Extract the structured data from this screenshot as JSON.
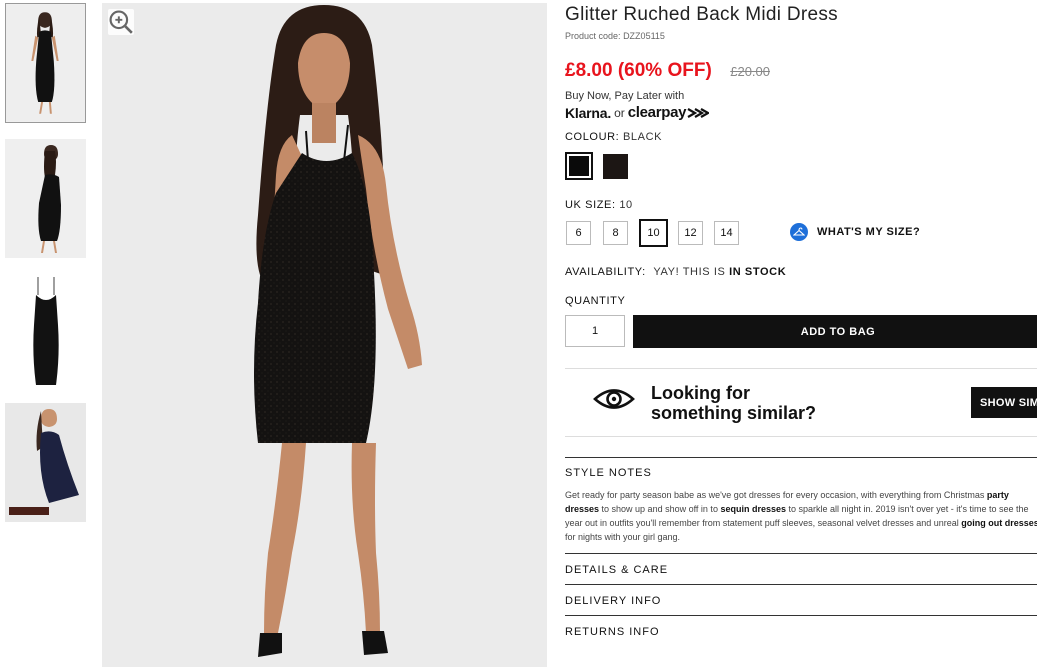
{
  "product": {
    "title": "Glitter Ruched Back Midi Dress",
    "code_label": "Product code:",
    "code": "DZZ05115",
    "price_now": "£8.00 (60% OFF)",
    "price_was": "£20.00"
  },
  "bnpl": {
    "text": "Buy Now, Pay Later with",
    "klarna": "Klarna.",
    "or": "or",
    "clearpay": "clearpay"
  },
  "colour": {
    "label": "COLOUR:",
    "selected": "BLACK",
    "swatches": [
      {
        "name": "black",
        "hex": "#0a0a0a"
      },
      {
        "name": "black-glitter",
        "hex": "#1c1614"
      }
    ]
  },
  "size": {
    "label": "UK SIZE:",
    "selected": "10",
    "options": [
      "6",
      "8",
      "10",
      "12",
      "14"
    ],
    "help_label": "WHAT'S MY SIZE?"
  },
  "availability": {
    "label": "AVAILABILITY:",
    "text": "YAY! THIS IS",
    "status": "IN STOCK"
  },
  "quantity": {
    "label": "QUANTITY",
    "value": "1"
  },
  "add_to_bag": "ADD TO BAG",
  "similar": {
    "line1": "Looking for",
    "line2": "something similar?",
    "button": "SHOW SIMILAR"
  },
  "style_notes": {
    "heading": "STYLE NOTES",
    "l1": "Get ready for party season babe as we've got dresses for every occasion, with everything from Christmas ",
    "l1_link": "party",
    "l2_link1": "dresses",
    "l2_mid": " to show up and show off in to ",
    "l2_link2": "sequin dresses",
    "l2_end": " to sparkle all night in. 2019 isn't over yet - it's time to see the",
    "l3": "year out in outfits you'll remember from statement puff sleeves, seasonal velvet dresses and unreal ",
    "l3_link": "going out dresses",
    "l4": "for nights with your girl gang."
  },
  "accordion": {
    "details": "DETAILS & CARE",
    "delivery": "DELIVERY INFO",
    "returns": "RETURNS INFO"
  },
  "icons": {
    "zoom": "zoom-in-icon",
    "eye": "eye-icon",
    "size_help": "hanger-icon"
  },
  "colors": {
    "sale_red": "#e8141d",
    "black": "#111111",
    "help_blue": "#1e6fd9"
  }
}
